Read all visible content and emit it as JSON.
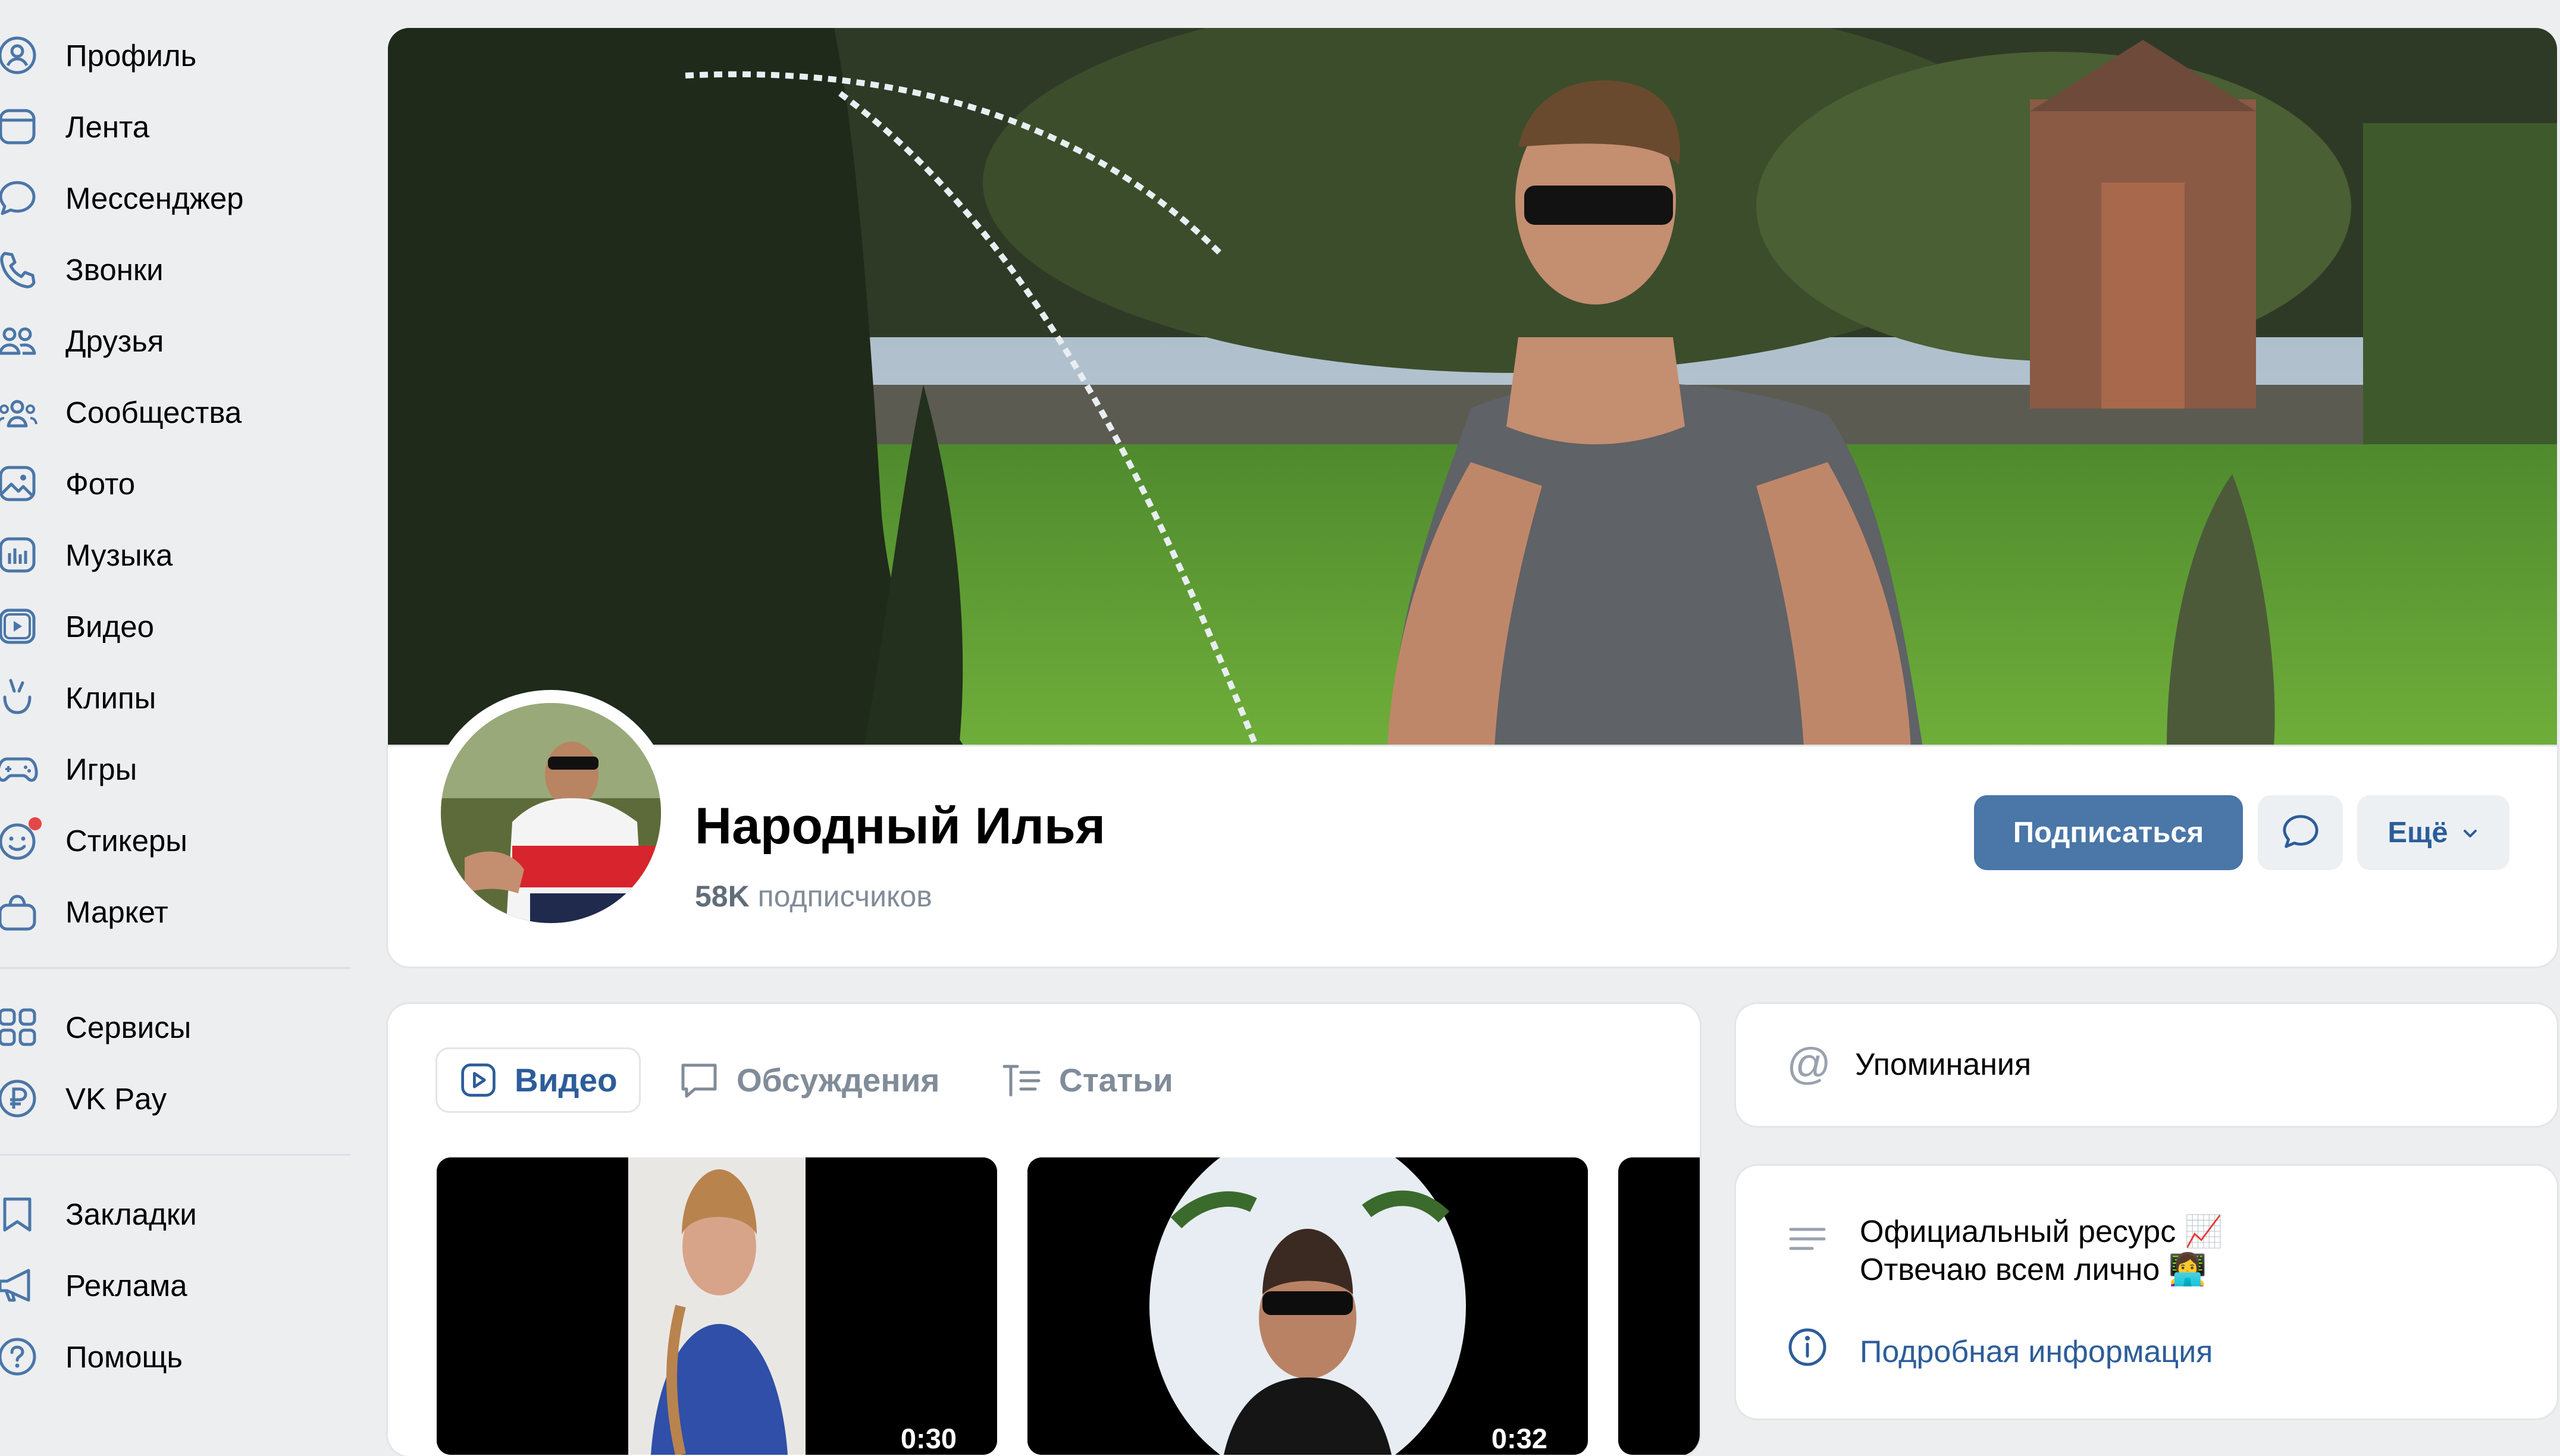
{
  "sidebar": {
    "items": [
      {
        "label": "Профиль",
        "icon": "user-icon"
      },
      {
        "label": "Лента",
        "icon": "newsfeed-icon"
      },
      {
        "label": "Мессенджер",
        "icon": "message-icon"
      },
      {
        "label": "Звонки",
        "icon": "phone-icon"
      },
      {
        "label": "Друзья",
        "icon": "friends-icon"
      },
      {
        "label": "Сообщества",
        "icon": "communities-icon"
      },
      {
        "label": "Фото",
        "icon": "photo-icon"
      },
      {
        "label": "Музыка",
        "icon": "music-icon"
      },
      {
        "label": "Видео",
        "icon": "video-icon"
      },
      {
        "label": "Клипы",
        "icon": "clips-icon"
      },
      {
        "label": "Игры",
        "icon": "gamepad-icon"
      },
      {
        "label": "Стикеры",
        "icon": "sticker-icon"
      },
      {
        "label": "Маркет",
        "icon": "market-bag-icon"
      },
      {
        "label": "Сервисы",
        "icon": "services-grid-icon"
      },
      {
        "label": "VK Pay",
        "icon": "ruble-coin-icon"
      },
      {
        "label": "Закладки",
        "icon": "bookmark-icon"
      },
      {
        "label": "Реклама",
        "icon": "megaphone-icon"
      },
      {
        "label": "Помощь",
        "icon": "help-icon"
      }
    ]
  },
  "profile": {
    "name": "Народный Илья",
    "followers_count": "58K",
    "followers_label": "подписчиков",
    "subscribe_label": "Подписаться",
    "more_label": "Ещё"
  },
  "tabs": [
    {
      "label": "Видео",
      "active": true
    },
    {
      "label": "Обсуждения",
      "active": false
    },
    {
      "label": "Статьи",
      "active": false
    }
  ],
  "videos": [
    {
      "duration": "0:30"
    },
    {
      "duration": "0:32"
    }
  ],
  "side": {
    "mentions_label": "Упоминания",
    "description_line1": "Официальный ресурс",
    "description_line2": "Отвечаю всем лично",
    "details_label": "Подробная информация"
  },
  "colors": {
    "accent": "#4a76a8",
    "link": "#2c5d99",
    "background": "#edeef0",
    "muted_text": "#818c99",
    "notification_dot": "#e64646"
  }
}
